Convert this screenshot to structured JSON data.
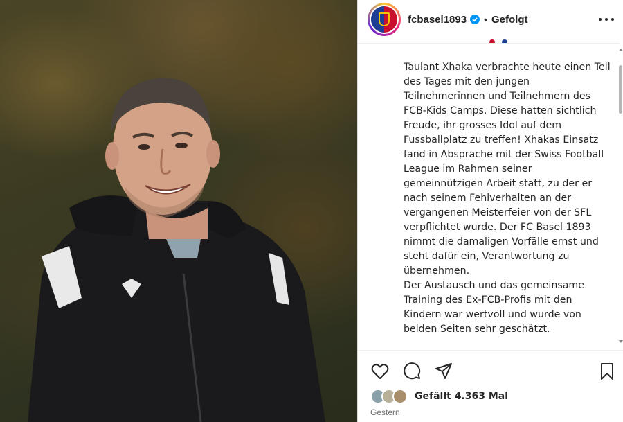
{
  "post": {
    "username": "fcbasel1893",
    "separator": "•",
    "follow_status": "Gefolgt",
    "caption": "Taulant Xhaka verbrachte heute einen Teil des Tages mit den jungen Teilnehmerinnen und Teilnehmern des FCB-Kids Camps. Diese hatten sichtlich Freude, ihr grosses Idol auf dem Fussballplatz zu treffen! Xhakas Einsatz fand in Absprache mit der Swiss Football League im Rahmen seiner gemeinnützigen Arbeit statt, zu der er nach seinem Fehlverhalten an der vergangenen Meisterfeier von der SFL verpflichtet wurde. Der FC Basel 1893 nimmt die damaligen Vorfälle ernst und steht dafür ein, Verantwortung zu übernehmen.\nDer Austausch und das gemeinsame Training des Ex-FCB-Profis mit den Kindern war wertvoll und wurde von beiden Seiten sehr geschätzt.",
    "likes_text": "Gefällt 4.363 Mal",
    "timestamp": "Gestern"
  },
  "icons": {
    "verified": "verified-badge-icon",
    "more": "more-options-icon",
    "like": "heart-icon",
    "comment": "comment-icon",
    "share": "send-icon",
    "save": "bookmark-icon"
  },
  "colors": {
    "verified_blue": "#0095f6",
    "text": "#262626",
    "muted": "#737373",
    "club_red": "#c8102e",
    "club_blue": "#1c3f94"
  }
}
